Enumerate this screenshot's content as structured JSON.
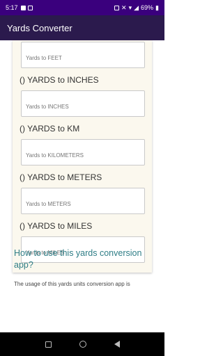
{
  "status": {
    "time": "5:17",
    "battery": "69%"
  },
  "app_bar": {
    "title": "Yards Converter"
  },
  "fields": [
    {
      "label": "",
      "placeholder": "Yards to FEET"
    },
    {
      "label": "() YARDS to INCHES",
      "placeholder": "Yards to INCHES"
    },
    {
      "label": "() YARDS to KM",
      "placeholder": "Yards to KILOMETERS"
    },
    {
      "label": "() YARDS to METERS",
      "placeholder": "Yards to METERS"
    },
    {
      "label": "() YARDS to MILES",
      "placeholder": "Yards to MILES"
    }
  ],
  "howto": {
    "title": "How to use this yards conversion app?",
    "text": "The usage of this yards units conversion app is"
  }
}
